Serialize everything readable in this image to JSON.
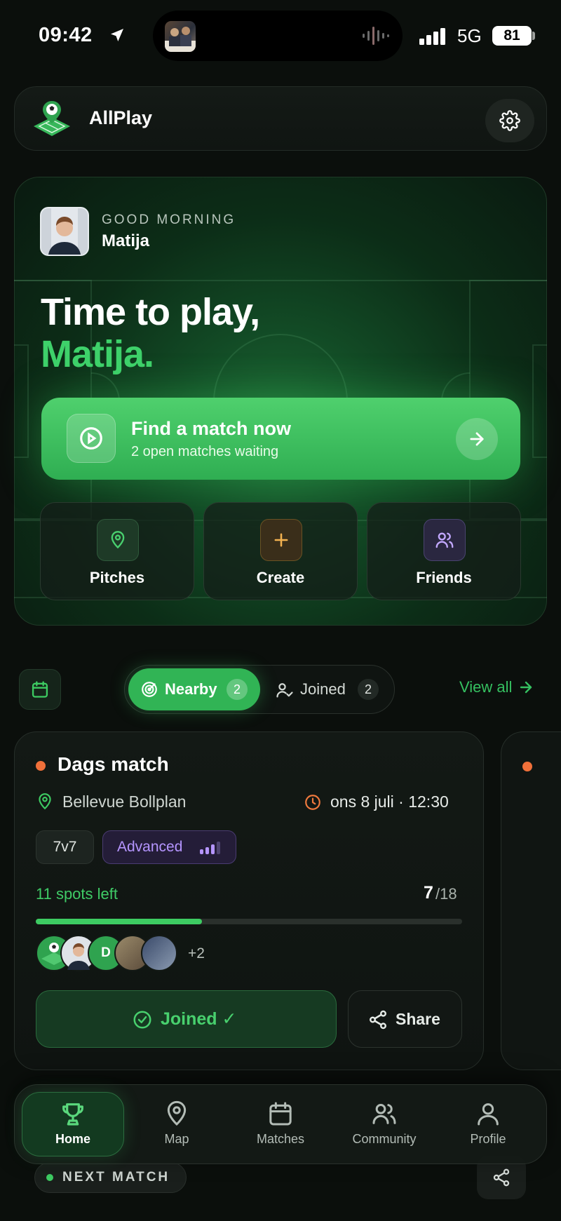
{
  "status": {
    "time": "09:42",
    "network": "5G",
    "battery": "81"
  },
  "header": {
    "app_name": "AllPlay",
    "logo_icon": "pitch-pin-logo-icon",
    "settings_icon": "gear-icon"
  },
  "hero": {
    "greeting": "GOOD MORNING",
    "user_name": "Matija",
    "headline_line1": "Time to play,",
    "headline_line2": "Matija.",
    "cta_title": "Find a match now",
    "cta_subtitle": "2 open matches waiting",
    "quick_actions": [
      {
        "label": "Pitches",
        "icon": "map-pin-icon"
      },
      {
        "label": "Create",
        "icon": "plus-icon"
      },
      {
        "label": "Friends",
        "icon": "users-icon"
      }
    ]
  },
  "tabs": {
    "nearby_label": "Nearby",
    "nearby_count": "2",
    "joined_label": "Joined",
    "joined_count": "2",
    "view_all": "View all"
  },
  "match": {
    "title": "Dags match",
    "location": "Bellevue Bollplan",
    "datetime": "ons 8 juli · 12:30",
    "format": "7v7",
    "level": "Advanced",
    "spots_left": "11 spots left",
    "players_current": "7",
    "players_total": "/18",
    "fill_fraction": 0.389,
    "extra_players": "+2",
    "avatar_initial": "D",
    "joined_label": "Joined ✓",
    "share_label": "Share"
  },
  "next_match": {
    "label": "NEXT MATCH"
  },
  "nav": [
    {
      "label": "Home",
      "icon": "trophy-icon",
      "active": true
    },
    {
      "label": "Map",
      "icon": "map-pin-icon"
    },
    {
      "label": "Matches",
      "icon": "calendar-icon"
    },
    {
      "label": "Community",
      "icon": "users-icon"
    },
    {
      "label": "Profile",
      "icon": "user-icon"
    }
  ],
  "colors": {
    "accent": "#3ed16a",
    "background": "#0b0f0c",
    "advanced": "#b595ff",
    "live_dot": "#f0703a"
  }
}
